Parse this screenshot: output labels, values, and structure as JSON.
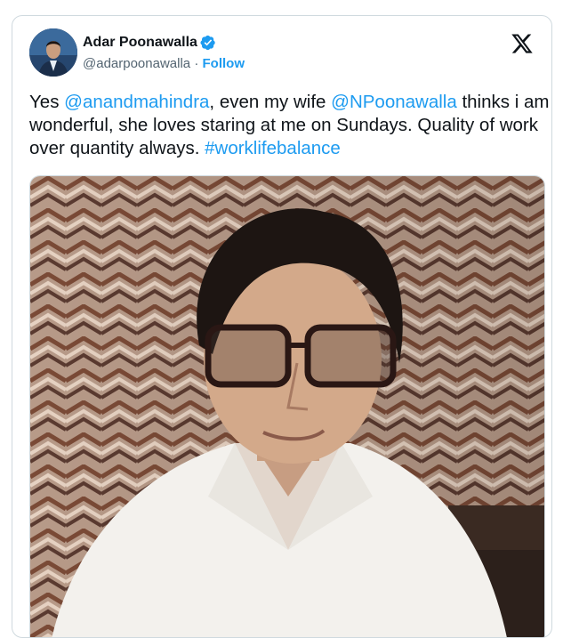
{
  "author": {
    "display_name": "Adar Poonawalla",
    "handle": "@adarpoonawalla",
    "separator": " · ",
    "follow_label": "Follow",
    "verified": true
  },
  "tweet": {
    "parts": {
      "p1": "Yes ",
      "mention1": "@anandmahindra",
      "p2": ", even my wife ",
      "mention2": "@NPoonawalla",
      "p3": " thinks i am wonderful, she loves staring at me on Sundays. Quality of work over quantity always. ",
      "hashtag": "#worklifebalance"
    }
  },
  "icons": {
    "platform_logo": "x-logo-icon",
    "verified_badge": "verified-badge-icon"
  },
  "colors": {
    "link": "#1d9bf0",
    "text": "#0f1419",
    "secondary": "#536471",
    "border": "#cfd9de"
  }
}
